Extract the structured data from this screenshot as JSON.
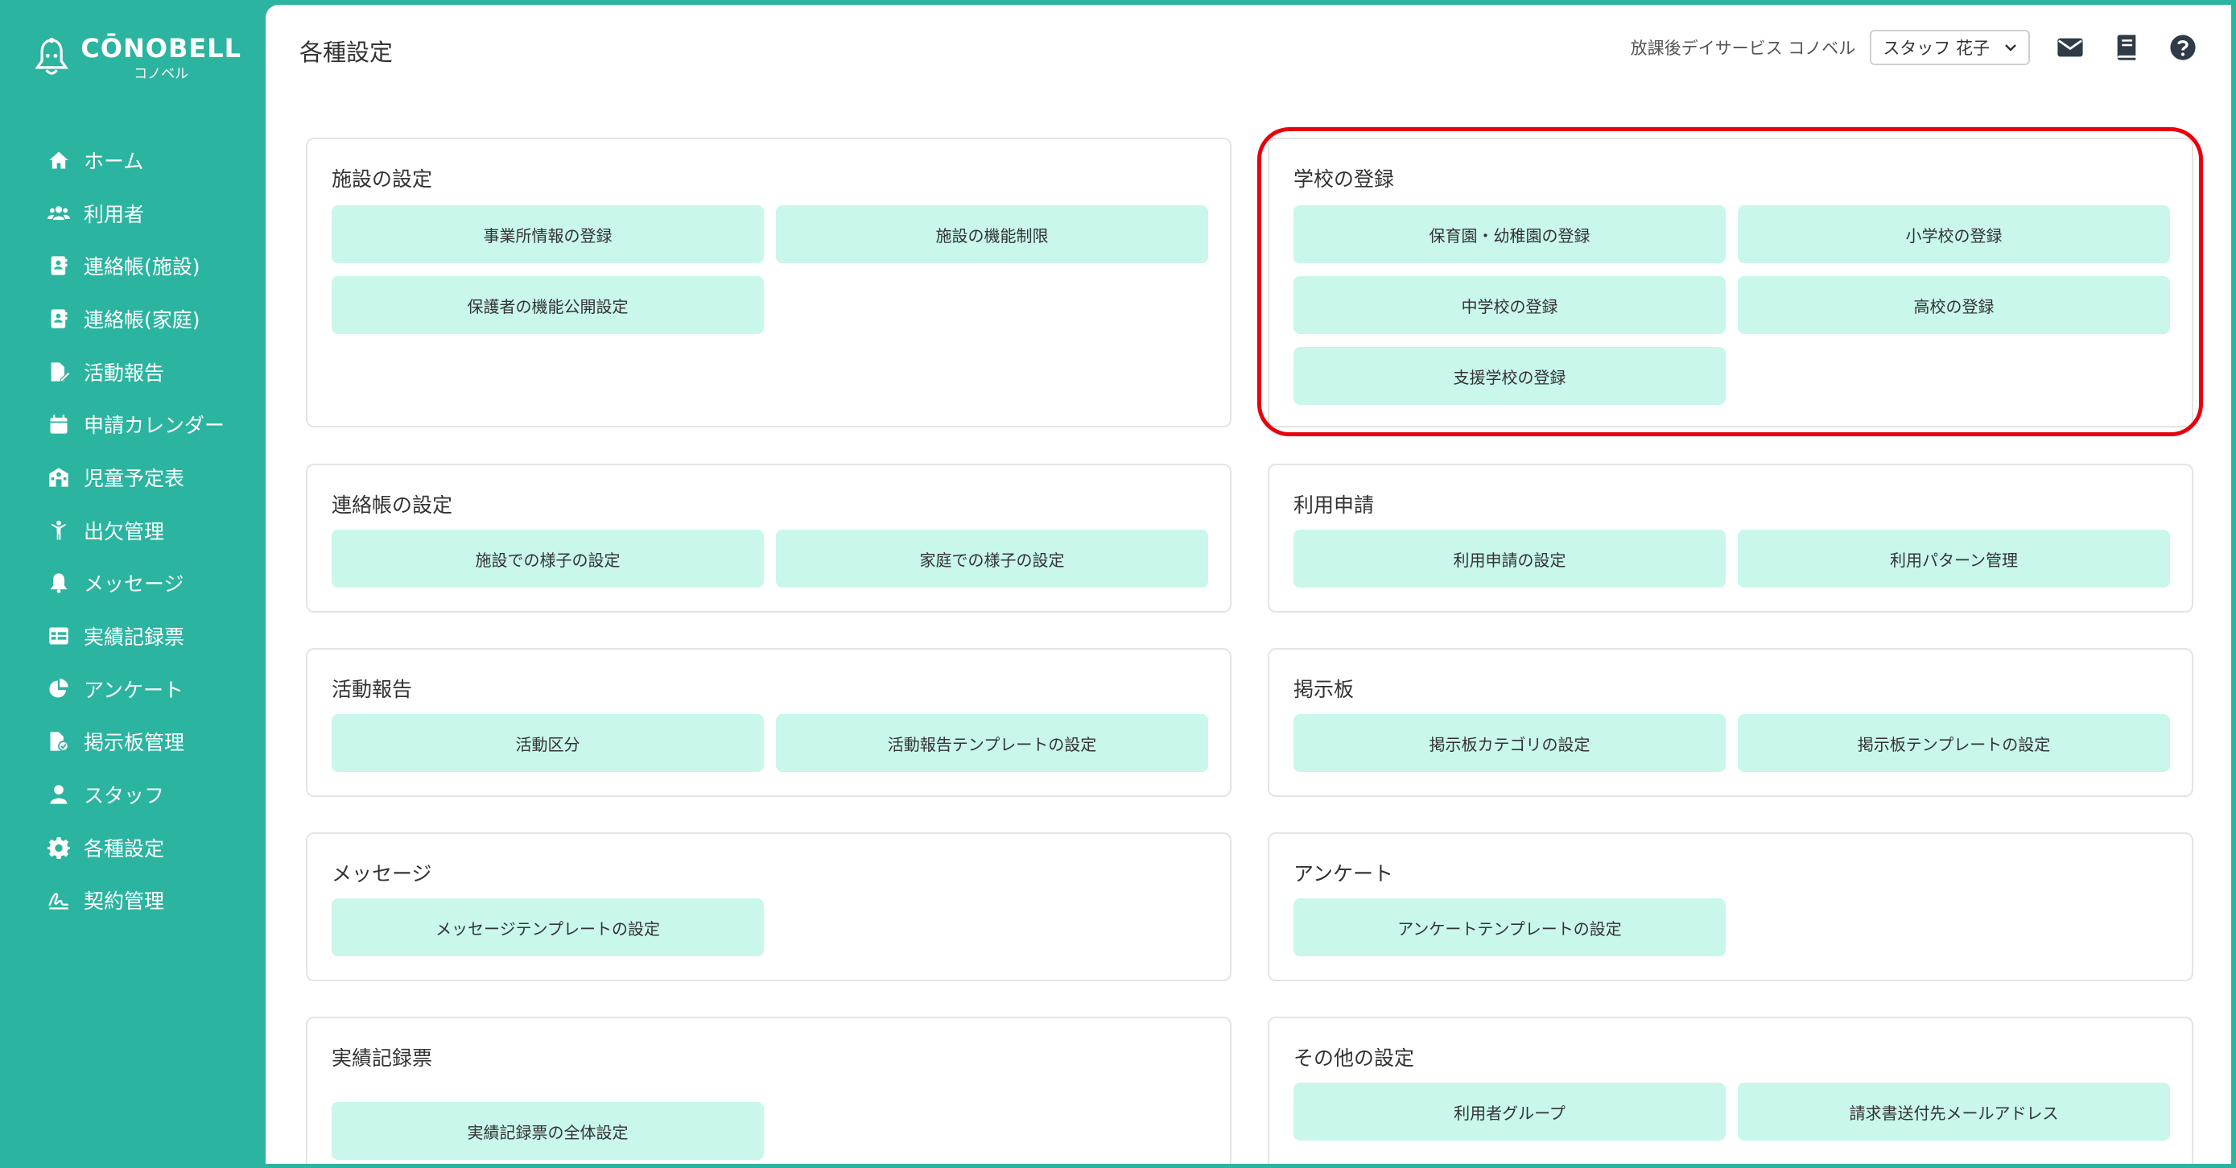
{
  "app": {
    "logo_main": "CŌNOBELL",
    "logo_sub": "コノベル"
  },
  "sidebar": {
    "items": [
      {
        "label": "ホーム",
        "icon": "home-icon"
      },
      {
        "label": "利用者",
        "icon": "users-icon"
      },
      {
        "label": "連絡帳(施設)",
        "icon": "contact-book-icon"
      },
      {
        "label": "連絡帳(家庭)",
        "icon": "contact-book-icon"
      },
      {
        "label": "活動報告",
        "icon": "report-edit-icon"
      },
      {
        "label": "申請カレンダー",
        "icon": "calendar-icon"
      },
      {
        "label": "児童予定表",
        "icon": "school-schedule-icon"
      },
      {
        "label": "出欠管理",
        "icon": "attendance-icon"
      },
      {
        "label": "メッセージ",
        "icon": "bell-icon"
      },
      {
        "label": "実績記録票",
        "icon": "table-icon"
      },
      {
        "label": "アンケート",
        "icon": "pie-chart-icon"
      },
      {
        "label": "掲示板管理",
        "icon": "board-file-icon"
      },
      {
        "label": "スタッフ",
        "icon": "staff-icon"
      },
      {
        "label": "各種設定",
        "icon": "gear-icon"
      },
      {
        "label": "契約管理",
        "icon": "contract-signature-icon"
      }
    ]
  },
  "header": {
    "title": "各種設定",
    "facility": "放課後デイサービス コノベル",
    "staff_selected": "スタッフ 花子"
  },
  "cards": {
    "facility": {
      "title": "施設の設定",
      "buttons": [
        "事業所情報の登録",
        "施設の機能制限",
        "保護者の機能公開設定"
      ]
    },
    "school": {
      "title": "学校の登録",
      "buttons": [
        "保育園・幼稚園の登録",
        "小学校の登録",
        "中学校の登録",
        "高校の登録",
        "支援学校の登録"
      ]
    },
    "contact": {
      "title": "連絡帳の設定",
      "buttons": [
        "施設での様子の設定",
        "家庭での様子の設定"
      ]
    },
    "usage": {
      "title": "利用申請",
      "buttons": [
        "利用申請の設定",
        "利用パターン管理"
      ]
    },
    "activity": {
      "title": "活動報告",
      "buttons": [
        "活動区分",
        "活動報告テンプレートの設定"
      ]
    },
    "board": {
      "title": "掲示板",
      "buttons": [
        "掲示板カテゴリの設定",
        "掲示板テンプレートの設定"
      ]
    },
    "message": {
      "title": "メッセージ",
      "buttons": [
        "メッセージテンプレートの設定"
      ]
    },
    "survey": {
      "title": "アンケート",
      "buttons": [
        "アンケートテンプレートの設定"
      ]
    },
    "record": {
      "title": "実績記録票",
      "buttons": [
        "実績記録票の全体設定"
      ]
    },
    "other": {
      "title": "その他の設定",
      "buttons": [
        "利用者グループ",
        "請求書送付先メールアドレス"
      ]
    }
  },
  "colors": {
    "brand": "#2bb4a0",
    "button_bg": "#c9f7ec",
    "highlight": "#e8000b"
  }
}
